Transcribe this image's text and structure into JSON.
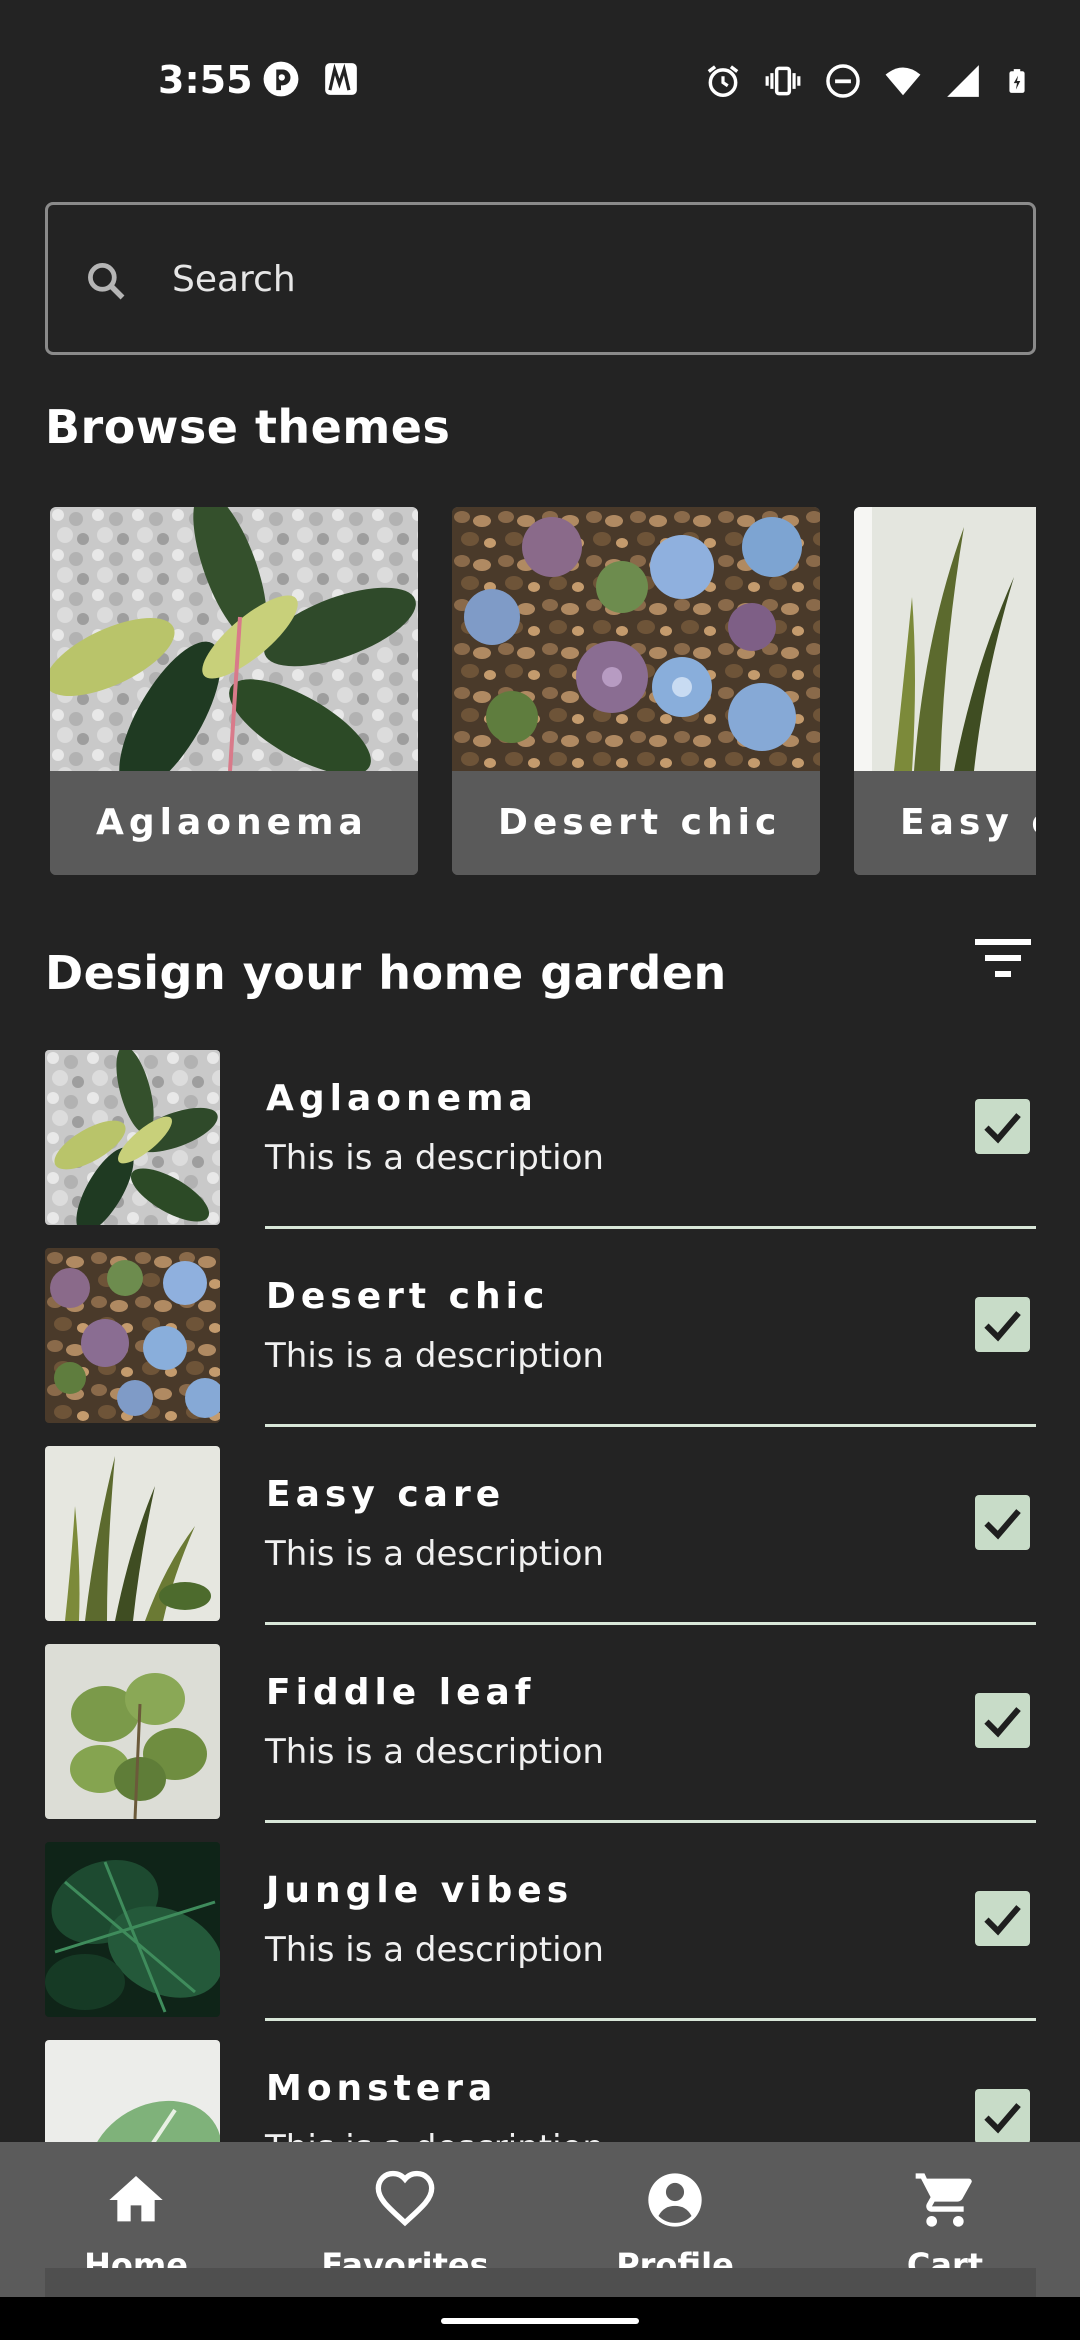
{
  "status_bar": {
    "time": "3:55",
    "left_icons": [
      "pocket-casts-icon",
      "app-icon"
    ],
    "right_icons": [
      "alarm-icon",
      "vibrate-icon",
      "do-not-disturb-icon",
      "wifi-icon",
      "signal-icon",
      "battery-icon"
    ]
  },
  "search": {
    "placeholder": "Search",
    "icon": "search-icon"
  },
  "browse": {
    "title": "Browse themes",
    "themes": [
      {
        "label": "Aglaonema"
      },
      {
        "label": "Desert chic"
      },
      {
        "label": "Easy care"
      }
    ]
  },
  "garden": {
    "title": "Design your home garden",
    "filter_icon": "filter-icon",
    "items": [
      {
        "title": "Aglaonema",
        "description": "This is a description",
        "checked": true
      },
      {
        "title": "Desert chic",
        "description": "This is a description",
        "checked": true
      },
      {
        "title": "Easy care",
        "description": "This is a description",
        "checked": true
      },
      {
        "title": "Fiddle leaf",
        "description": "This is a description",
        "checked": true
      },
      {
        "title": "Jungle vibes",
        "description": "This is a description",
        "checked": true
      },
      {
        "title": "Monstera",
        "description": "This is a description",
        "checked": true
      }
    ]
  },
  "nav": {
    "items": [
      {
        "label": "Home",
        "icon": "home-icon"
      },
      {
        "label": "Favorites",
        "icon": "heart-icon"
      },
      {
        "label": "Profile",
        "icon": "account-circle-icon"
      },
      {
        "label": "Cart",
        "icon": "cart-icon"
      }
    ]
  },
  "colors": {
    "background": "#232323",
    "nav_background": "#5b5b5b",
    "card_label_background": "#5a5a5a",
    "checkbox_fill": "#c8dcc8",
    "divider": "#d8e6d8"
  }
}
